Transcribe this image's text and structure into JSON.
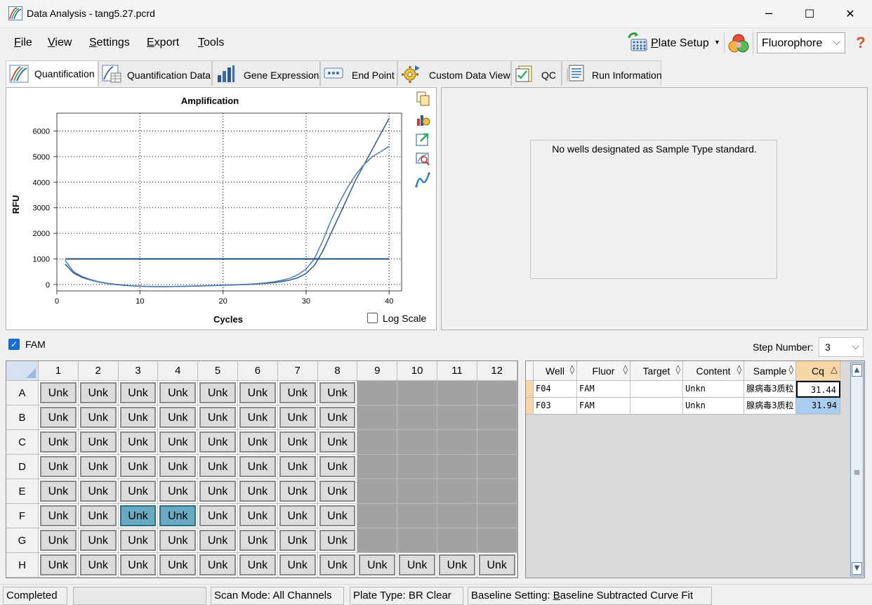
{
  "window": {
    "title": "Data Analysis - tang5.27.pcrd",
    "minimize_glyph": "─",
    "maximize_glyph": "☐",
    "close_glyph": "✕"
  },
  "menu": [
    {
      "pre": "",
      "key": "F",
      "post": "ile"
    },
    {
      "pre": "",
      "key": "V",
      "post": "iew"
    },
    {
      "pre": "",
      "key": "S",
      "post": "ettings"
    },
    {
      "pre": "",
      "key": "E",
      "post": "xport"
    },
    {
      "pre": "",
      "key": "T",
      "post": "ools"
    }
  ],
  "toolbar": {
    "plate_setup_key": "P",
    "plate_setup_rest": "late Setup",
    "plate_setup_caret": "▼",
    "fluor_selected": "Fluorophore",
    "select_caret": "⌵",
    "help_glyph": "?"
  },
  "tabs": [
    {
      "label": "Quantification",
      "icon": "amplification-icon",
      "active": true
    },
    {
      "label": "Quantification Data",
      "icon": "quant-data-icon",
      "active": false
    },
    {
      "label": "Gene Expression",
      "icon": "gene-expression-icon",
      "active": false
    },
    {
      "label": "End Point",
      "icon": "end-point-icon",
      "active": false
    },
    {
      "label": "Custom Data View",
      "icon": "custom-view-icon",
      "active": false
    },
    {
      "label": "QC",
      "icon": "qc-icon",
      "active": false
    },
    {
      "label": "Run Information",
      "icon": "run-info-icon",
      "active": false
    }
  ],
  "chart_data": {
    "type": "line",
    "title": "Amplification",
    "xlabel": "Cycles",
    "ylabel": "RFU",
    "xlim": [
      0,
      41.5
    ],
    "ylim": [
      -250,
      6700
    ],
    "xticks": [
      0,
      10,
      20,
      30,
      40
    ],
    "yticks": [
      0,
      1000,
      2000,
      3000,
      4000,
      5000,
      6000
    ],
    "grid": true,
    "threshold": 1000,
    "threshold_x": [
      1,
      40
    ],
    "series": [
      {
        "color": "#2e5a8c",
        "x": [
          1,
          2,
          3,
          4,
          5,
          6,
          7,
          8,
          9,
          10,
          11,
          12,
          13,
          14,
          15,
          16,
          17,
          18,
          19,
          20,
          21,
          22,
          23,
          24,
          25,
          26,
          27,
          28,
          29,
          30,
          31,
          32,
          33,
          34,
          35,
          36,
          37,
          38,
          39,
          40
        ],
        "y": [
          800,
          450,
          280,
          180,
          100,
          40,
          0,
          -30,
          -50,
          -70,
          -80,
          -85,
          -85,
          -80,
          -75,
          -70,
          -60,
          -50,
          -40,
          -30,
          -20,
          -10,
          0,
          20,
          40,
          70,
          110,
          170,
          260,
          430,
          750,
          1300,
          2000,
          2700,
          3400,
          4100,
          4700,
          5300,
          5900,
          6500
        ]
      },
      {
        "color": "#4c7bb4",
        "x": [
          1,
          2,
          3,
          4,
          5,
          6,
          7,
          8,
          9,
          10,
          11,
          12,
          13,
          14,
          15,
          16,
          17,
          18,
          19,
          20,
          21,
          22,
          23,
          24,
          25,
          26,
          27,
          28,
          29,
          30,
          31,
          32,
          33,
          34,
          35,
          36,
          37,
          38,
          39,
          40
        ],
        "y": [
          950,
          500,
          320,
          200,
          110,
          50,
          10,
          -20,
          -45,
          -65,
          -75,
          -80,
          -80,
          -78,
          -72,
          -65,
          -55,
          -45,
          -35,
          -25,
          -15,
          -5,
          10,
          30,
          60,
          100,
          160,
          240,
          380,
          600,
          1000,
          1700,
          2500,
          3200,
          3800,
          4300,
          4700,
          5000,
          5200,
          5400
        ]
      }
    ],
    "log_scale_label": "Log Scale",
    "log_scale": false
  },
  "side_icons": [
    "copy-icon",
    "chart-settings-icon",
    "export-chart-icon",
    "zoom-chart-icon",
    "curve-icon"
  ],
  "standard_panel": {
    "message": "No wells designated as Sample Type standard."
  },
  "fluor_filter": {
    "label": "FAM",
    "checked": true,
    "check_glyph": "✓"
  },
  "step": {
    "label": "Step Number:",
    "value": "3"
  },
  "plate": {
    "columns": [
      "1",
      "2",
      "3",
      "4",
      "5",
      "6",
      "7",
      "8",
      "9",
      "10",
      "11",
      "12"
    ],
    "rows": [
      {
        "label": "A",
        "wells": [
          "Unk",
          "Unk",
          "Unk",
          "Unk",
          "Unk",
          "Unk",
          "Unk",
          "Unk",
          "",
          "",
          "",
          ""
        ],
        "selected": []
      },
      {
        "label": "B",
        "wells": [
          "Unk",
          "Unk",
          "Unk",
          "Unk",
          "Unk",
          "Unk",
          "Unk",
          "Unk",
          "",
          "",
          "",
          ""
        ],
        "selected": []
      },
      {
        "label": "C",
        "wells": [
          "Unk",
          "Unk",
          "Unk",
          "Unk",
          "Unk",
          "Unk",
          "Unk",
          "Unk",
          "",
          "",
          "",
          ""
        ],
        "selected": []
      },
      {
        "label": "D",
        "wells": [
          "Unk",
          "Unk",
          "Unk",
          "Unk",
          "Unk",
          "Unk",
          "Unk",
          "Unk",
          "",
          "",
          "",
          ""
        ],
        "selected": []
      },
      {
        "label": "E",
        "wells": [
          "Unk",
          "Unk",
          "Unk",
          "Unk",
          "Unk",
          "Unk",
          "Unk",
          "Unk",
          "",
          "",
          "",
          ""
        ],
        "selected": []
      },
      {
        "label": "F",
        "wells": [
          "Unk",
          "Unk",
          "Unk",
          "Unk",
          "Unk",
          "Unk",
          "Unk",
          "Unk",
          "",
          "",
          "",
          ""
        ],
        "selected": [
          2,
          3
        ]
      },
      {
        "label": "G",
        "wells": [
          "Unk",
          "Unk",
          "Unk",
          "Unk",
          "Unk",
          "Unk",
          "Unk",
          "Unk",
          "",
          "",
          "",
          ""
        ],
        "selected": []
      },
      {
        "label": "H",
        "wells": [
          "Unk",
          "Unk",
          "Unk",
          "Unk",
          "Unk",
          "Unk",
          "Unk",
          "Unk",
          "Unk",
          "Unk",
          "Unk",
          "Unk"
        ],
        "selected": []
      }
    ]
  },
  "table": {
    "sort_glyph": "◊",
    "sort_active_glyph": "△",
    "headers": [
      "Well",
      "Fluor",
      "Target",
      "Content",
      "Sample",
      "Cq"
    ],
    "rows": [
      {
        "well": "F04",
        "fluor": "FAM",
        "target": "",
        "content": "Unkn",
        "sample": "腺病毒3质粒",
        "cq": "31.44"
      },
      {
        "well": "F03",
        "fluor": "FAM",
        "target": "",
        "content": "Unkn",
        "sample": "腺病毒3质粒",
        "cq": "31.94"
      }
    ],
    "scroll_up": "▲",
    "scroll_down": "▼",
    "scroll_grip": "≡"
  },
  "status": {
    "state": "Completed",
    "progress": "",
    "scan_mode": "Scan Mode: All Channels",
    "plate_type": "Plate Type: BR Clear",
    "baseline_pre": "Baseline Setting: ",
    "baseline_key": "B",
    "baseline_rest": "aseline Subtracted Curve Fit"
  },
  "colors": {
    "selected_well": "#6aa9c2",
    "cq_selected_cell": "#a9cdef",
    "threshold_line": "#1f4e79"
  }
}
